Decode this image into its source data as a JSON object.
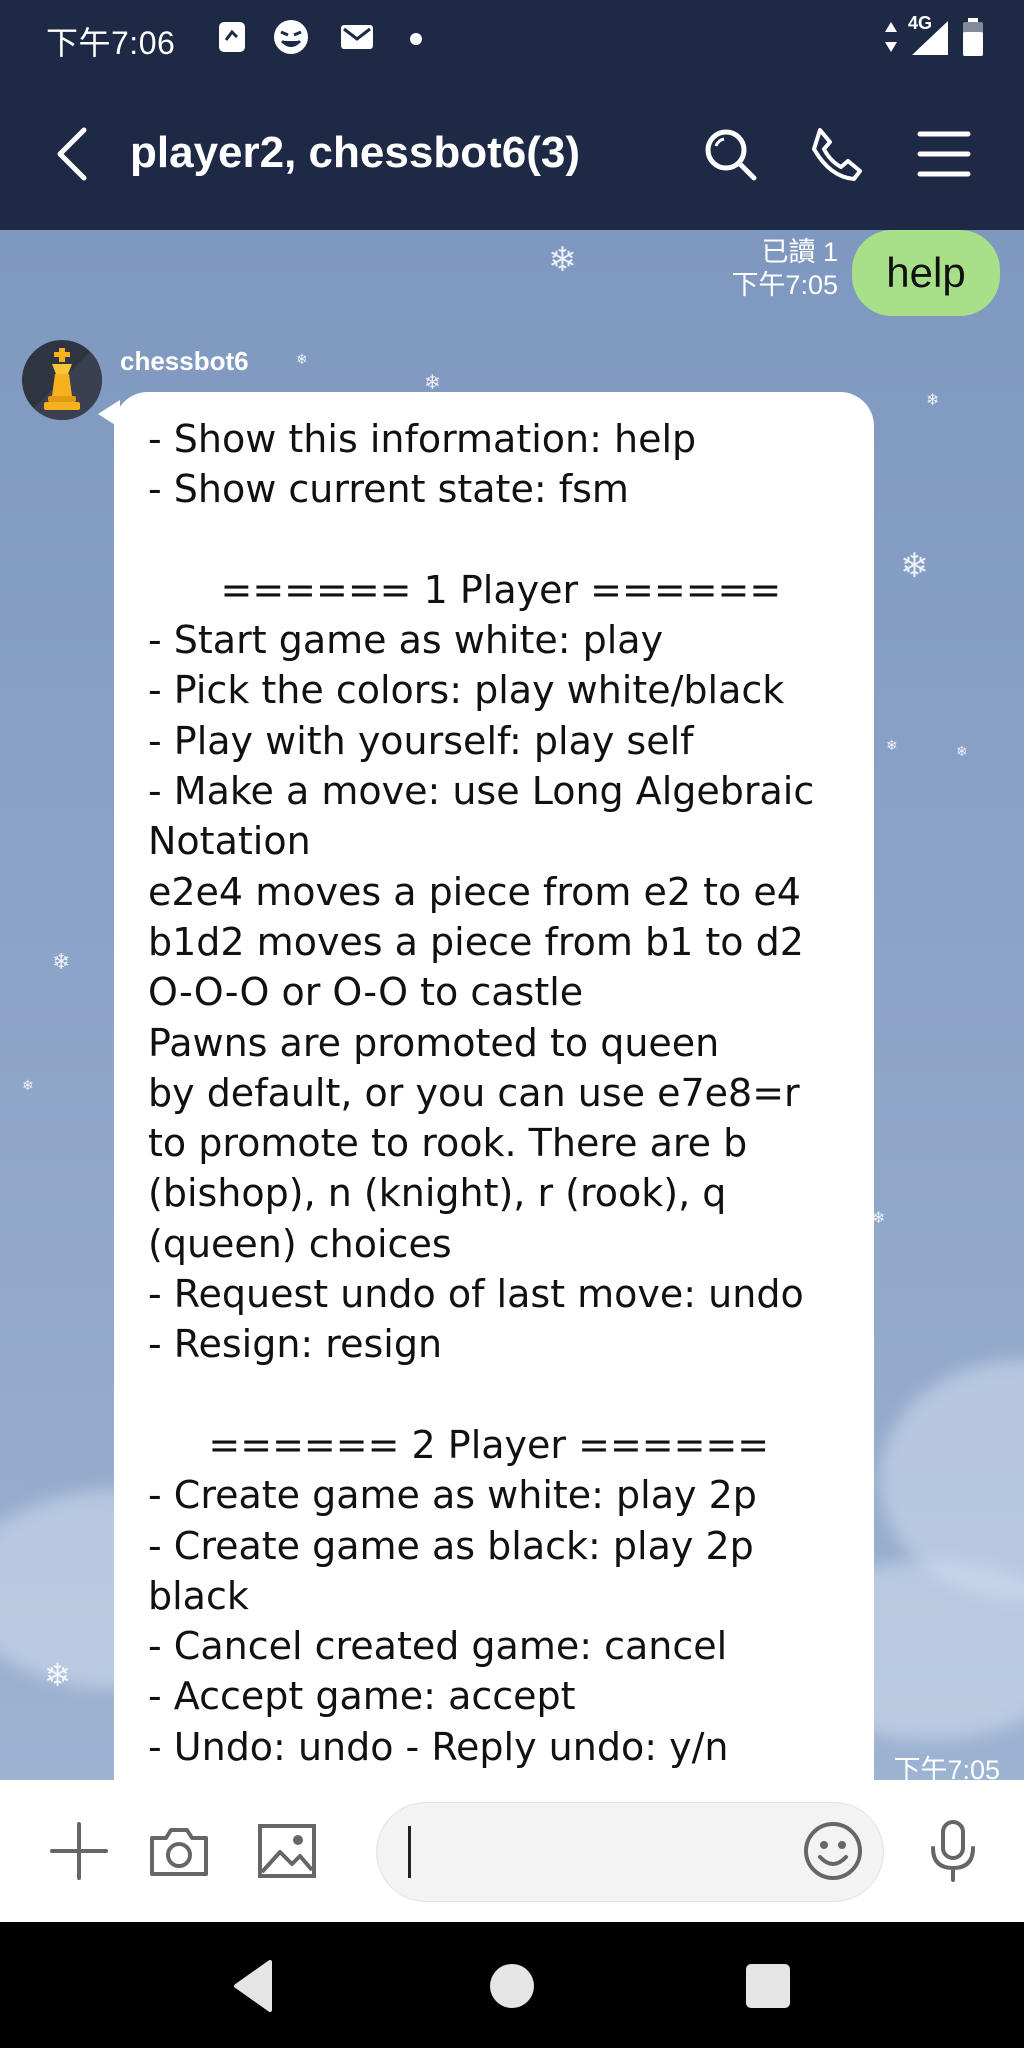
{
  "status_bar": {
    "time": "下午7:06",
    "network": "4G",
    "icons": [
      "notes-icon",
      "ghost-face-icon",
      "mail-icon",
      "dot-icon",
      "data-arrows-icon",
      "signal-icon",
      "battery-icon"
    ]
  },
  "header": {
    "title": "player2, chessbot6(3)",
    "icons": [
      "back-arrow-icon",
      "search-icon",
      "phone-icon",
      "menu-icon"
    ]
  },
  "messages": {
    "outgoing": {
      "text": "help",
      "read_status": "已讀 1",
      "time": "下午7:05"
    },
    "incoming": {
      "sender": "chessbot6",
      "time": "下午7:05",
      "text": "- Show this information: help\n- Show current state: fsm\n\n      ====== 1 Player ======\n- Start game as white: play\n- Pick the colors: play white/black\n- Play with yourself: play self\n- Make a move: use Long Algebraic\nNotation\ne2e4 moves a piece from e2 to e4\nb1d2 moves a piece from b1 to d2\nO-O-O or O-O to castle\nPawns are promoted to queen\nby default, or you can use e7e8=r\nto promote to rook. There are b\n(bishop), n (knight), r (rook), q\n(queen) choices\n- Request undo of last move: undo\n- Resign: resign\n\n     ====== 2 Player ======\n- Create game as white: play 2p\n- Create game as black: play 2p\nblack\n- Cancel created game: cancel\n- Accept game: accept\n- Undo: undo - Reply undo: y/n"
    }
  },
  "input_bar": {
    "icons": [
      "plus-icon",
      "camera-icon",
      "image-icon",
      "emoji-icon",
      "microphone-icon"
    ],
    "value": ""
  },
  "nav_bar": {
    "icons": [
      "back-triangle-icon",
      "home-circle-icon",
      "recents-square-icon"
    ]
  },
  "colors": {
    "header_bg": "#1e2a45",
    "outgoing_bubble": "#a8e08a",
    "incoming_bubble": "#ffffff",
    "chat_bg": "#8aa2c6"
  }
}
